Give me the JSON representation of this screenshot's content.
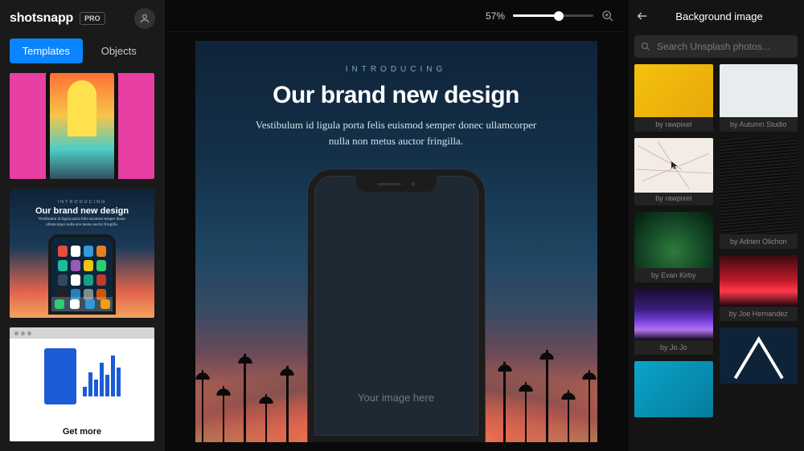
{
  "header": {
    "logo": "shotsnapp",
    "badge": "PRO"
  },
  "sidebar": {
    "tabs": {
      "templates": "Templates",
      "objects": "Objects"
    },
    "templates": {
      "t2": {
        "overline": "INTRODUCING",
        "headline": "Our brand new design",
        "sub": "Vestibulum id ligula porta felis euismod semper donec ullamcorper nulla non metus auctor fringilla."
      },
      "t3": {
        "headline": "Get more"
      }
    }
  },
  "toolbar": {
    "zoom_label": "57%"
  },
  "canvas": {
    "overline": "INTRODUCING",
    "headline": "Our brand new design",
    "sub": "Vestibulum id ligula porta felis euismod semper donec ullamcorper nulla non metus auctor fringilla.",
    "placeholder": "Your image here"
  },
  "right": {
    "title": "Background image",
    "search_placeholder": "Search Unsplash photos...",
    "items": [
      {
        "credit": "by rawpixel"
      },
      {
        "credit": "by Autumn Studio"
      },
      {
        "credit": "by rawpixel"
      },
      {
        "credit": "by Evan Kirby"
      },
      {
        "credit": "by Adrien Olichon"
      },
      {
        "credit": "by Jo Jo"
      },
      {
        "credit": "by Joe Hernandez"
      }
    ]
  }
}
